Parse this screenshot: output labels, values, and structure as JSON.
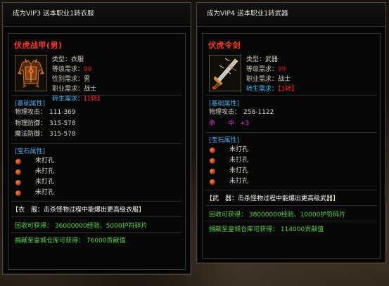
{
  "left": {
    "title": "成为VIP3 送本职业1转衣服",
    "item_name": "伏虎战甲(男)",
    "icon": "armor-icon",
    "attributes": [
      {
        "label": "类型：",
        "value": "衣服",
        "value_color": "plain"
      },
      {
        "label": "等级需求：",
        "value": "99",
        "value_color": "red"
      },
      {
        "label": "性别需求：",
        "value": "男",
        "value_color": "plain"
      },
      {
        "label": "职业需求：",
        "value": "战士",
        "value_color": "plain"
      }
    ],
    "rebirth": {
      "label": "转生需求：",
      "value": "【1转】"
    },
    "base_title": "[基础属性]",
    "base_stats": [
      {
        "label": "物理攻击：",
        "value": "111-369"
      },
      {
        "label": "物理防御：",
        "value": "315-578"
      },
      {
        "label": "魔法防御：",
        "value": "315-578"
      }
    ],
    "gem_title": "[宝石属性]",
    "gem_slots": [
      "未打孔",
      "未打孔",
      "未打孔",
      "未打孔"
    ],
    "drop_note": {
      "open": "【",
      "text": "衣　服：击杀怪物过程中能爆出更高级衣服",
      "close": "】"
    },
    "recycle": "回收可获得： 36000000经验、5000护符碎片",
    "donate": "捐献至皇城仓库可获得： 76000贡献值"
  },
  "right": {
    "title": "成为VIP4 送本职业1转武器",
    "item_name": "伏虎令剑",
    "icon": "sword-icon",
    "attributes": [
      {
        "label": "类型：",
        "value": "武器",
        "value_color": "plain"
      },
      {
        "label": "等级需求：",
        "value": "99",
        "value_color": "red"
      },
      {
        "label": "职业需求：",
        "value": "战士",
        "value_color": "plain"
      }
    ],
    "rebirth": {
      "label": "转生需求：",
      "value": "【1转】"
    },
    "base_title": "[基础属性]",
    "base_stats": [
      {
        "label": "物理攻击：",
        "value": "258-1122"
      }
    ],
    "luck": {
      "label": "命　　中",
      "value": "+3"
    },
    "gem_title": "[宝石属性]",
    "gem_slots": [
      "未打孔",
      "未打孔",
      "未打孔",
      "未打孔"
    ],
    "drop_note": {
      "open": "【",
      "text": "武　器：击杀怪物过程中能爆出更高级武器",
      "close": "】"
    },
    "recycle": "回收可获得： 38000000经验、10000护符碎片",
    "donate": "捐献至皇城仓库可获得： 114000贡献值"
  },
  "colors": {
    "red": "#e01818",
    "cyan": "#38b8f0",
    "green": "#5cd44a",
    "item_name": "#ff3a2a",
    "yellow": "#ffea40",
    "magenta": "#d63cd6"
  }
}
